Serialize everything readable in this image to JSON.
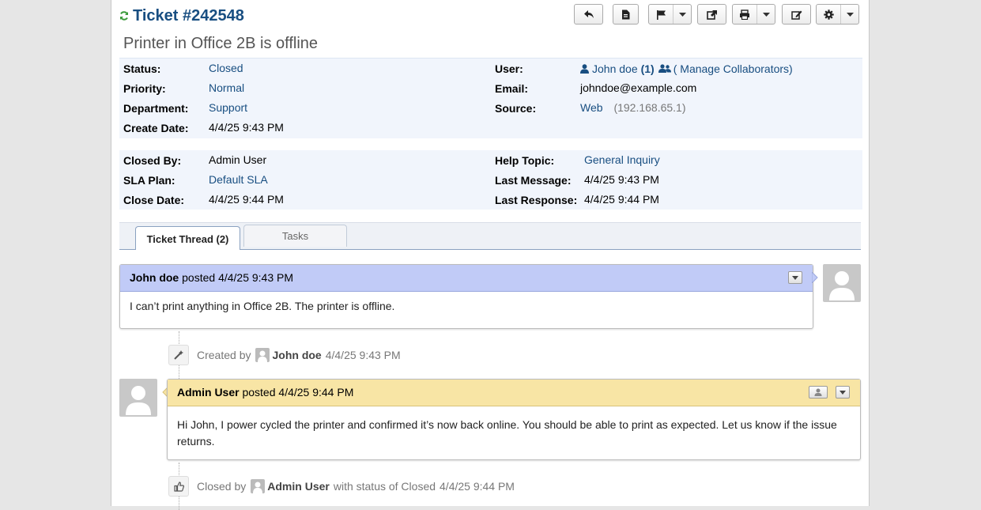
{
  "ticket": {
    "title": "Ticket #242548",
    "subject": "Printer in Office 2B is offline"
  },
  "toolbar": {
    "icons": [
      "reply-icon",
      "note-icon",
      "flag-icon",
      "share-icon",
      "print-icon",
      "edit-icon",
      "gear-icon"
    ]
  },
  "info": {
    "status_label": "Status:",
    "status": "Closed",
    "priority_label": "Priority:",
    "priority": "Normal",
    "department_label": "Department:",
    "department": "Support",
    "create_date_label": "Create Date:",
    "create_date": "4/4/25 9:43 PM",
    "user_label": "User:",
    "user": "John doe",
    "user_count": "(1)",
    "collaborators": "( Manage Collaborators)",
    "email_label": "Email:",
    "email": "johndoe@example.com",
    "source_label": "Source:",
    "source": "Web",
    "source_ip": "(192.168.65.1)"
  },
  "info2": {
    "closed_by_label": "Closed By:",
    "closed_by": "Admin User",
    "sla_label": "SLA Plan:",
    "sla": "Default SLA",
    "close_date_label": "Close Date:",
    "close_date": "4/4/25 9:44 PM",
    "help_topic_label": "Help Topic:",
    "help_topic": "General Inquiry",
    "last_message_label": "Last Message:",
    "last_message": "4/4/25 9:43 PM",
    "last_response_label": "Last Response:",
    "last_response": "4/4/25 9:44 PM"
  },
  "tabs": [
    {
      "label": "Ticket Thread (2)",
      "active": true
    },
    {
      "label": "Tasks",
      "active": false
    }
  ],
  "thread": {
    "message": {
      "author": "John doe",
      "posted": "posted",
      "time": "4/4/25 9:43 PM",
      "body": "I can’t print anything in Office 2B. The printer is offline."
    },
    "event_created": {
      "prefix": "Created by",
      "who": "John doe",
      "time": "4/4/25 9:43 PM"
    },
    "response": {
      "author": "Admin User",
      "posted": "posted",
      "time": "4/4/25 9:44 PM",
      "body": "Hi John, I power cycled the printer and confirmed it’s now back online. You should be able to print as expected. Let us know if the issue returns."
    },
    "event_closed": {
      "prefix": "Closed by",
      "who": "Admin User",
      "suffix": "with status of Closed",
      "time": "4/4/25 9:44 PM"
    }
  },
  "colors": {
    "link": "#184E81",
    "message_header": "#C1CBF7",
    "response_header": "#F8E5A5",
    "info_bg": "#F1F5FC"
  }
}
